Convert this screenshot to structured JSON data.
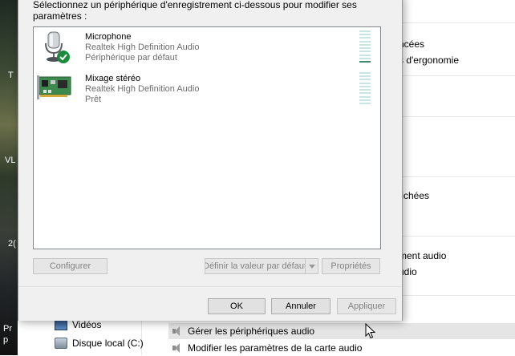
{
  "desktop": {
    "letters": [
      "T",
      "VL",
      "2(",
      "Pr",
      "p"
    ]
  },
  "background": {
    "right_fragments": [
      "ncées",
      "s d'ergonomie",
      "fichées",
      "ment audio",
      "udio"
    ],
    "nav": {
      "videos": "Vidéos",
      "local_disk": "Disque local (C:)"
    },
    "tasks": {
      "manage_audio": "Gérer les périphériques audio",
      "sound_card": "Modifier les paramètres de la carte audio"
    }
  },
  "dialog": {
    "instruction": "Sélectionnez un périphérique d'enregistrement ci-dessous pour modifier ses paramètres :",
    "devices": [
      {
        "name": "Microphone",
        "driver": "Realtek High Definition Audio",
        "status": "Périphérique par défaut",
        "icon": "microphone-icon",
        "default": true
      },
      {
        "name": "Mixage stéréo",
        "driver": "Realtek High Definition Audio",
        "status": "Prêt",
        "icon": "sound-card-icon",
        "default": false
      }
    ],
    "buttons": {
      "configure": "Configurer",
      "set_default": "Définir la valeur par défaut",
      "properties": "Propriétés",
      "ok": "OK",
      "cancel": "Annuler",
      "apply": "Appliquer"
    }
  },
  "colors": {
    "default_check": "#1c8a3c",
    "meter_active": "#3a8a6e",
    "meter_idle": "#c7e6e3",
    "hover_row": "#e5e5e5"
  }
}
